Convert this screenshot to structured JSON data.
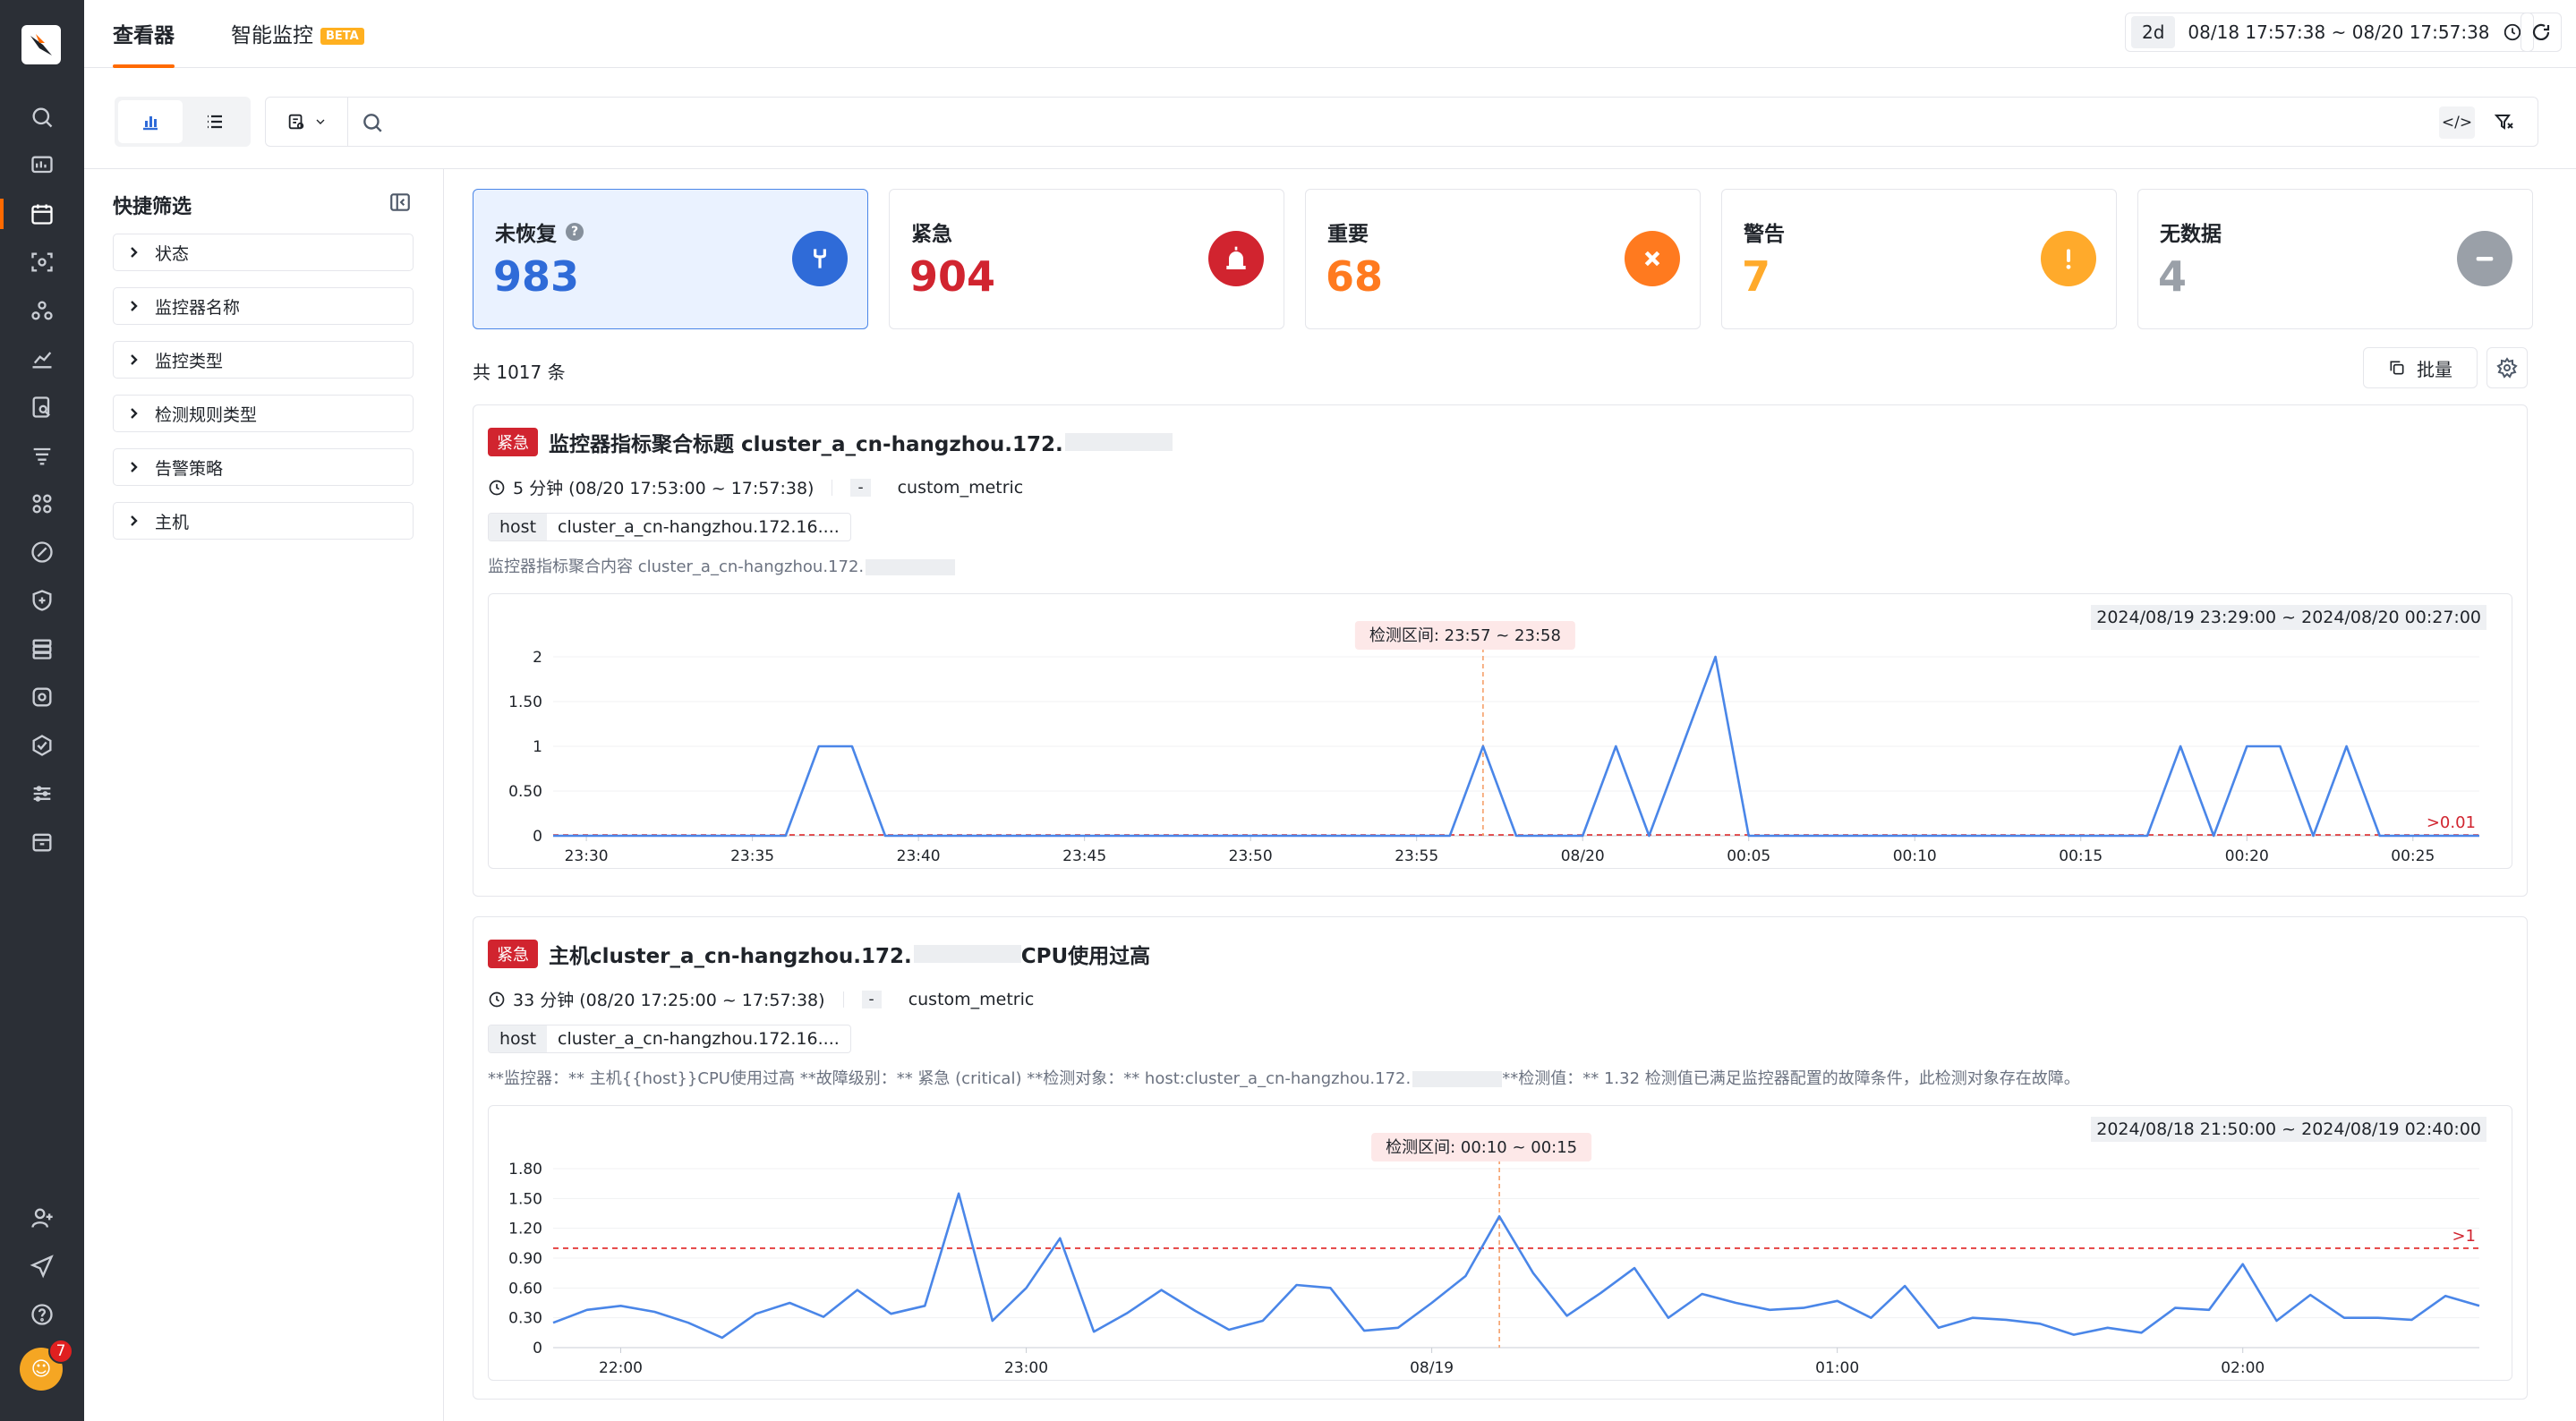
{
  "colors": {
    "accent": "#ff6a00",
    "unrecovered": "#2f6bd8",
    "critical": "#d1242f",
    "important": "#ff7a1f",
    "warning": "#ffaa2b",
    "nodata": "#9aa0a8",
    "line": "#4a86e8"
  },
  "header": {
    "tabs": [
      {
        "label": "查看器",
        "active": true
      },
      {
        "label": "智能监控",
        "badge": "BETA"
      }
    ],
    "time": {
      "relative": "2d",
      "absolute": "08/18 17:57:38 ~ 08/20 17:57:38"
    }
  },
  "toolbar": {
    "search_placeholder": "",
    "code_icon": "</>"
  },
  "quick_filter": {
    "title": "快捷筛选",
    "items": [
      "状态",
      "监控器名称",
      "监控类型",
      "检测规则类型",
      "告警策略",
      "主机"
    ]
  },
  "summary": [
    {
      "label": "未恢复",
      "value": "983",
      "icon": "wrench-icon",
      "help": true
    },
    {
      "label": "紧急",
      "value": "904",
      "icon": "siren-icon"
    },
    {
      "label": "重要",
      "value": "68",
      "icon": "x-icon"
    },
    {
      "label": "警告",
      "value": "7",
      "icon": "exclamation-icon"
    },
    {
      "label": "无数据",
      "value": "4",
      "icon": "minus-icon"
    }
  ],
  "list": {
    "total": "共 1017 条",
    "batch_label": "批量"
  },
  "events": [
    {
      "level": "紧急",
      "title": "监控器指标聚合标题 cluster_a_cn-hangzhou.172.",
      "title_suffix": "",
      "duration": "5 分钟 (08/20 17:53:00 ~ 17:57:38)",
      "dash": "-",
      "source": "custom_metric",
      "tag_key": "host",
      "tag_value": "cluster_a_cn-hangzhou.172.16....",
      "desc": "监控器指标聚合内容 cluster_a_cn-hangzhou.172.",
      "desc_suffix": "",
      "chart_range": "2024/08/19 23:29:00 ~ 2024/08/20 00:27:00"
    },
    {
      "level": "紧急",
      "title": "主机cluster_a_cn-hangzhou.172.",
      "title_suffix": "CPU使用过高",
      "duration": "33 分钟 (08/20 17:25:00 ~ 17:57:38)",
      "dash": "-",
      "source": "custom_metric",
      "tag_key": "host",
      "tag_value": "cluster_a_cn-hangzhou.172.16....",
      "desc": "**监控器：** 主机{{host}}CPU使用过高 **故障级别：** 紧急 (critical) **检测对象：** host:cluster_a_cn-hangzhou.172.",
      "desc_suffix": "**检测值：** 1.32 检测值已满足监控器配置的故障条件，此检测对象存在故障。",
      "chart_range": "2024/08/18 21:50:00 ~ 2024/08/19 02:40:00"
    }
  ],
  "chart_data": [
    {
      "type": "line",
      "x": [
        0,
        1,
        2,
        3,
        4,
        5,
        6,
        7,
        8,
        9,
        10,
        11,
        12,
        13,
        14,
        15,
        16,
        17,
        18,
        19,
        20,
        21,
        22,
        23,
        24,
        25,
        26,
        27,
        28,
        29,
        30,
        31,
        32,
        33,
        34,
        35,
        36,
        37,
        38,
        39,
        40,
        41,
        42,
        43,
        44,
        45,
        46,
        47,
        48,
        49,
        50,
        51,
        52,
        53,
        54,
        55,
        56,
        57,
        58
      ],
      "values": [
        0,
        0,
        0,
        0,
        0,
        0,
        0,
        0,
        1,
        1,
        0,
        0,
        0,
        0,
        0,
        0,
        0,
        0,
        0,
        0,
        0,
        0,
        0,
        0,
        0,
        0,
        0,
        0,
        1,
        0,
        0,
        0,
        1,
        0,
        1,
        2,
        0,
        0,
        0,
        0,
        0,
        0,
        0,
        0,
        0,
        0,
        0,
        0,
        0,
        1,
        0,
        1,
        1,
        0,
        1,
        0,
        0,
        0,
        0
      ],
      "xticks": [
        {
          "at": 1,
          "label": "23:30"
        },
        {
          "at": 6,
          "label": "23:35"
        },
        {
          "at": 11,
          "label": "23:40"
        },
        {
          "at": 16,
          "label": "23:45"
        },
        {
          "at": 21,
          "label": "23:50"
        },
        {
          "at": 26,
          "label": "23:55"
        },
        {
          "at": 31,
          "label": "08/20"
        },
        {
          "at": 36,
          "label": "00:05"
        },
        {
          "at": 41,
          "label": "00:10"
        },
        {
          "at": 46,
          "label": "00:15"
        },
        {
          "at": 51,
          "label": "00:20"
        },
        {
          "at": 56,
          "label": "00:25"
        }
      ],
      "yticks": [
        "0",
        "0.50",
        "1",
        "1.50",
        "2"
      ],
      "ylim": [
        0,
        2
      ],
      "threshold": 0.01,
      "threshold_label": ">0.01",
      "detect_at": 28,
      "detect_label": "检测区间: 23:57 ~ 23:58"
    },
    {
      "type": "line",
      "x": [
        0,
        1,
        2,
        3,
        4,
        5,
        6,
        7,
        8,
        9,
        10,
        11,
        12,
        13,
        14,
        15,
        16,
        17,
        18,
        19,
        20,
        21,
        22,
        23,
        24,
        25,
        26,
        27,
        28,
        29,
        30,
        31,
        32,
        33,
        34,
        35,
        36,
        37,
        38,
        39,
        40,
        41,
        42,
        43,
        44,
        45,
        46,
        47,
        48,
        49,
        50,
        51,
        52,
        53,
        54,
        55,
        56,
        57
      ],
      "values": [
        0.25,
        0.38,
        0.42,
        0.36,
        0.25,
        0.1,
        0.34,
        0.45,
        0.31,
        0.58,
        0.34,
        0.42,
        1.55,
        0.27,
        0.6,
        1.1,
        0.16,
        0.35,
        0.58,
        0.37,
        0.18,
        0.27,
        0.63,
        0.6,
        0.17,
        0.2,
        0.45,
        0.72,
        1.32,
        0.75,
        0.32,
        0.55,
        0.8,
        0.3,
        0.54,
        0.45,
        0.38,
        0.4,
        0.47,
        0.3,
        0.62,
        0.2,
        0.3,
        0.28,
        0.24,
        0.13,
        0.2,
        0.15,
        0.4,
        0.38,
        0.84,
        0.27,
        0.53,
        0.3,
        0.3,
        0.28,
        0.52,
        0.42
      ],
      "xticks": [
        {
          "at": 2,
          "label": "22:00"
        },
        {
          "at": 14,
          "label": "23:00"
        },
        {
          "at": 26,
          "label": "08/19"
        },
        {
          "at": 38,
          "label": "01:00"
        },
        {
          "at": 50,
          "label": "02:00"
        }
      ],
      "yticks": [
        "0",
        "0.30",
        "0.60",
        "0.90",
        "1.20",
        "1.50",
        "1.80"
      ],
      "ylim": [
        0,
        1.8
      ],
      "threshold": 1,
      "threshold_label": ">1",
      "detect_at": 28,
      "detect_label": "检测区间: 00:10 ~ 00:15"
    }
  ]
}
